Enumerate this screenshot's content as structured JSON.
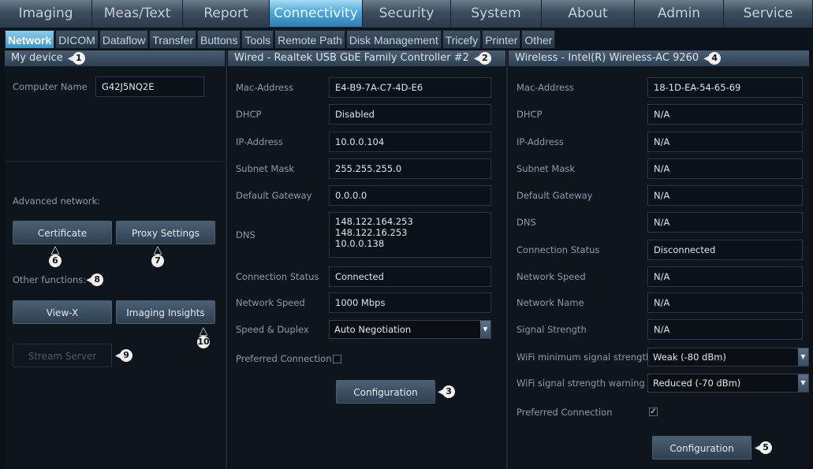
{
  "top_tabs": [
    "Imaging",
    "Meas/Text",
    "Report",
    "Connectivity",
    "Security",
    "System",
    "About",
    "Admin",
    "Service"
  ],
  "sub_tabs": [
    "Network",
    "DICOM",
    "Dataflow",
    "Transfer",
    "Buttons",
    "Tools",
    "Remote Path",
    "Disk Management",
    "Tricefy",
    "Printer",
    "Other"
  ],
  "my_device": {
    "title": "My device",
    "computer_name_label": "Computer Name",
    "computer_name_value": "G42J5NQ2E",
    "advanced_network_label": "Advanced network:",
    "certificate_button": "Certificate",
    "proxy_settings_button": "Proxy Settings",
    "other_functions_label": "Other functions:",
    "view_x_button": "View-X",
    "imaging_insights_button": "Imaging Insights",
    "stream_server_button": "Stream Server"
  },
  "wired": {
    "title": "Wired - Realtek USB GbE Family Controller #2",
    "labels": {
      "mac": "Mac-Address",
      "dhcp": "DHCP",
      "ip": "IP-Address",
      "subnet": "Subnet Mask",
      "gateway": "Default Gateway",
      "dns": "DNS",
      "status": "Connection Status",
      "speed": "Network Speed",
      "duplex": "Speed & Duplex",
      "preferred": "Preferred Connection"
    },
    "values": {
      "mac": "E4-B9-7A-C7-4D-E6",
      "dhcp": "Disabled",
      "ip": "10.0.0.104",
      "subnet": "255.255.255.0",
      "gateway": "0.0.0.0",
      "dns1": "148.122.164.253",
      "dns2": "148.122.16.253",
      "dns3": "10.0.0.138",
      "status": "Connected",
      "speed": "1000 Mbps",
      "duplex": "Auto Negotiation"
    },
    "preferred_checked": false,
    "configuration_button": "Configuration"
  },
  "wireless": {
    "title": "Wireless - Intel(R) Wireless-AC 9260",
    "labels": {
      "mac": "Mac-Address",
      "dhcp": "DHCP",
      "ip": "IP-Address",
      "subnet": "Subnet Mask",
      "gateway": "Default Gateway",
      "dns": "DNS",
      "status": "Connection Status",
      "speed": "Network Speed",
      "name": "Network Name",
      "signal": "Signal Strength",
      "wifi_min": "WiFi minimum signal strength",
      "wifi_warn": "WiFi signal strength warning",
      "preferred": "Preferred Connection"
    },
    "values": {
      "mac": "18-1D-EA-54-65-69",
      "dhcp": "N/A",
      "ip": "N/A",
      "subnet": "N/A",
      "gateway": "N/A",
      "dns": "N/A",
      "status": "Disconnected",
      "speed": "N/A",
      "name": "N/A",
      "signal": "N/A",
      "wifi_min": "Weak (-80 dBm)",
      "wifi_warn": "Reduced (-70 dBm)"
    },
    "preferred_checked": true,
    "checkmark": "✓",
    "configuration_button": "Configuration"
  },
  "callouts": [
    "1",
    "2",
    "3",
    "4",
    "5",
    "6",
    "7",
    "8",
    "9",
    "10"
  ],
  "colors": {
    "active_tab": "#4ea8d8",
    "panel_header": "#3b4e62",
    "background": "#0e151d"
  }
}
